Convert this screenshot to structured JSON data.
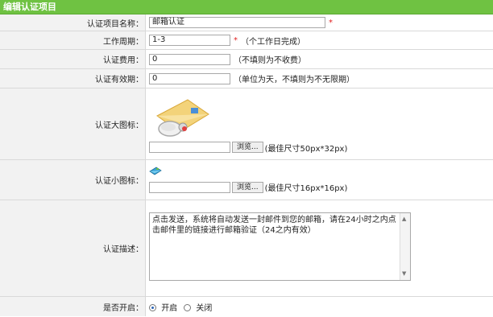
{
  "header": {
    "title": "编辑认证项目"
  },
  "form": {
    "name": {
      "label": "认证项目名称：",
      "value": "邮箱认证",
      "required": "*"
    },
    "period": {
      "label": "工作周期：",
      "value": "1-3",
      "required": "*",
      "hint": "（个工作日完成）"
    },
    "fee": {
      "label": "认证费用：",
      "value": "0",
      "hint": "（不填则为不收费）"
    },
    "validity": {
      "label": "认证有效期：",
      "value": "0",
      "hint": "（单位为天，不填则为不无限期）"
    },
    "large_icon": {
      "label": "认证大图标：",
      "image_icon": "email-envelope-magnifier-icon",
      "browse_label": "浏览...",
      "hint": "(最佳尺寸50px*32px)"
    },
    "small_icon": {
      "label": "认证小图标：",
      "image_icon": "small-email-icon",
      "browse_label": "浏览...",
      "hint": "(最佳尺寸16px*16px)"
    },
    "description": {
      "label": "认证描述：",
      "value": "点击发送，系统将自动发送一封邮件到您的邮箱，请在24小时之内点击邮件里的链接进行邮箱验证（24之内有效）"
    },
    "enabled": {
      "label": "是否开启：",
      "options": [
        "开启",
        "关闭"
      ],
      "selected": "开启"
    }
  },
  "colors": {
    "header_bg": "#6fc242",
    "required": "#e02020",
    "label_bg": "#f2f2f2"
  }
}
